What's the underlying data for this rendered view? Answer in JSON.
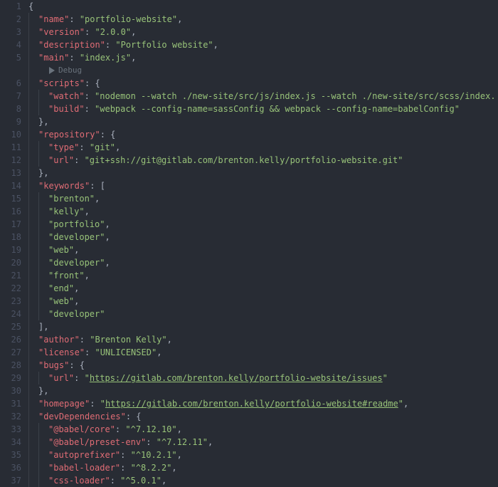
{
  "codelens": {
    "debug_label": "Debug"
  },
  "lines": [
    {
      "n": 1,
      "indent": 0,
      "tokens": [
        {
          "t": "punc",
          "v": "{"
        }
      ]
    },
    {
      "n": 2,
      "indent": 1,
      "tokens": [
        {
          "t": "key",
          "v": "\"name\""
        },
        {
          "t": "punc",
          "v": ": "
        },
        {
          "t": "str",
          "v": "\"portfolio-website\""
        },
        {
          "t": "punc",
          "v": ","
        }
      ]
    },
    {
      "n": 3,
      "indent": 1,
      "tokens": [
        {
          "t": "key",
          "v": "\"version\""
        },
        {
          "t": "punc",
          "v": ": "
        },
        {
          "t": "str",
          "v": "\"2.0.0\""
        },
        {
          "t": "punc",
          "v": ","
        }
      ]
    },
    {
      "n": 4,
      "indent": 1,
      "tokens": [
        {
          "t": "key",
          "v": "\"description\""
        },
        {
          "t": "punc",
          "v": ": "
        },
        {
          "t": "str",
          "v": "\"Portfolio website\""
        },
        {
          "t": "punc",
          "v": ","
        }
      ]
    },
    {
      "n": 5,
      "indent": 1,
      "tokens": [
        {
          "t": "key",
          "v": "\"main\""
        },
        {
          "t": "punc",
          "v": ": "
        },
        {
          "t": "str",
          "v": "\"index.js\""
        },
        {
          "t": "punc",
          "v": ","
        }
      ]
    },
    {
      "codelens": true
    },
    {
      "n": 6,
      "indent": 1,
      "tokens": [
        {
          "t": "key",
          "v": "\"scripts\""
        },
        {
          "t": "punc",
          "v": ": {"
        }
      ]
    },
    {
      "n": 7,
      "indent": 2,
      "tokens": [
        {
          "t": "key",
          "v": "\"watch\""
        },
        {
          "t": "punc",
          "v": ": "
        },
        {
          "t": "str",
          "v": "\"nodemon --watch ./new-site/src/js/index.js --watch ./new-site/src/scss/index."
        }
      ]
    },
    {
      "n": 8,
      "indent": 2,
      "tokens": [
        {
          "t": "key",
          "v": "\"build\""
        },
        {
          "t": "punc",
          "v": ": "
        },
        {
          "t": "str",
          "v": "\"webpack --config-name=sassConfig && webpack --config-name=babelConfig\""
        }
      ]
    },
    {
      "n": 9,
      "indent": 1,
      "tokens": [
        {
          "t": "punc",
          "v": "},"
        }
      ]
    },
    {
      "n": 10,
      "indent": 1,
      "tokens": [
        {
          "t": "key",
          "v": "\"repository\""
        },
        {
          "t": "punc",
          "v": ": {"
        }
      ]
    },
    {
      "n": 11,
      "indent": 2,
      "tokens": [
        {
          "t": "key",
          "v": "\"type\""
        },
        {
          "t": "punc",
          "v": ": "
        },
        {
          "t": "str",
          "v": "\"git\""
        },
        {
          "t": "punc",
          "v": ","
        }
      ]
    },
    {
      "n": 12,
      "indent": 2,
      "tokens": [
        {
          "t": "key",
          "v": "\"url\""
        },
        {
          "t": "punc",
          "v": ": "
        },
        {
          "t": "str",
          "v": "\"git+ssh://git@gitlab.com/brenton.kelly/portfolio-website.git\""
        }
      ]
    },
    {
      "n": 13,
      "indent": 1,
      "tokens": [
        {
          "t": "punc",
          "v": "},"
        }
      ]
    },
    {
      "n": 14,
      "indent": 1,
      "tokens": [
        {
          "t": "key",
          "v": "\"keywords\""
        },
        {
          "t": "punc",
          "v": ": ["
        }
      ]
    },
    {
      "n": 15,
      "indent": 2,
      "tokens": [
        {
          "t": "str",
          "v": "\"brenton\""
        },
        {
          "t": "punc",
          "v": ","
        }
      ]
    },
    {
      "n": 16,
      "indent": 2,
      "tokens": [
        {
          "t": "str",
          "v": "\"kelly\""
        },
        {
          "t": "punc",
          "v": ","
        }
      ]
    },
    {
      "n": 17,
      "indent": 2,
      "tokens": [
        {
          "t": "str",
          "v": "\"portfolio\""
        },
        {
          "t": "punc",
          "v": ","
        }
      ]
    },
    {
      "n": 18,
      "indent": 2,
      "tokens": [
        {
          "t": "str",
          "v": "\"developer\""
        },
        {
          "t": "punc",
          "v": ","
        }
      ]
    },
    {
      "n": 19,
      "indent": 2,
      "tokens": [
        {
          "t": "str",
          "v": "\"web\""
        },
        {
          "t": "punc",
          "v": ","
        }
      ]
    },
    {
      "n": 20,
      "indent": 2,
      "tokens": [
        {
          "t": "str",
          "v": "\"developer\""
        },
        {
          "t": "punc",
          "v": ","
        }
      ]
    },
    {
      "n": 21,
      "indent": 2,
      "tokens": [
        {
          "t": "str",
          "v": "\"front\""
        },
        {
          "t": "punc",
          "v": ","
        }
      ]
    },
    {
      "n": 22,
      "indent": 2,
      "tokens": [
        {
          "t": "str",
          "v": "\"end\""
        },
        {
          "t": "punc",
          "v": ","
        }
      ]
    },
    {
      "n": 23,
      "indent": 2,
      "tokens": [
        {
          "t": "str",
          "v": "\"web\""
        },
        {
          "t": "punc",
          "v": ","
        }
      ]
    },
    {
      "n": 24,
      "indent": 2,
      "tokens": [
        {
          "t": "str",
          "v": "\"developer\""
        }
      ]
    },
    {
      "n": 25,
      "indent": 1,
      "tokens": [
        {
          "t": "punc",
          "v": "],"
        }
      ]
    },
    {
      "n": 26,
      "indent": 1,
      "tokens": [
        {
          "t": "key",
          "v": "\"author\""
        },
        {
          "t": "punc",
          "v": ": "
        },
        {
          "t": "str",
          "v": "\"Brenton Kelly\""
        },
        {
          "t": "punc",
          "v": ","
        }
      ]
    },
    {
      "n": 27,
      "indent": 1,
      "tokens": [
        {
          "t": "key",
          "v": "\"license\""
        },
        {
          "t": "punc",
          "v": ": "
        },
        {
          "t": "str",
          "v": "\"UNLICENSED\""
        },
        {
          "t": "punc",
          "v": ","
        }
      ]
    },
    {
      "n": 28,
      "indent": 1,
      "tokens": [
        {
          "t": "key",
          "v": "\"bugs\""
        },
        {
          "t": "punc",
          "v": ": {"
        }
      ]
    },
    {
      "n": 29,
      "indent": 2,
      "tokens": [
        {
          "t": "key",
          "v": "\"url\""
        },
        {
          "t": "punc",
          "v": ": "
        },
        {
          "t": "str",
          "v": "\""
        },
        {
          "t": "link",
          "v": "https://gitlab.com/brenton.kelly/portfolio-website/issues"
        },
        {
          "t": "str",
          "v": "\""
        }
      ]
    },
    {
      "n": 30,
      "indent": 1,
      "tokens": [
        {
          "t": "punc",
          "v": "},"
        }
      ]
    },
    {
      "n": 31,
      "indent": 1,
      "tokens": [
        {
          "t": "key",
          "v": "\"homepage\""
        },
        {
          "t": "punc",
          "v": ": "
        },
        {
          "t": "str",
          "v": "\""
        },
        {
          "t": "link",
          "v": "https://gitlab.com/brenton.kelly/portfolio-website#readme"
        },
        {
          "t": "str",
          "v": "\""
        },
        {
          "t": "punc",
          "v": ","
        }
      ]
    },
    {
      "n": 32,
      "indent": 1,
      "tokens": [
        {
          "t": "key",
          "v": "\"devDependencies\""
        },
        {
          "t": "punc",
          "v": ": {"
        }
      ]
    },
    {
      "n": 33,
      "indent": 2,
      "tokens": [
        {
          "t": "key",
          "v": "\"@babel/core\""
        },
        {
          "t": "punc",
          "v": ": "
        },
        {
          "t": "str",
          "v": "\"^7.12.10\""
        },
        {
          "t": "punc",
          "v": ","
        }
      ]
    },
    {
      "n": 34,
      "indent": 2,
      "tokens": [
        {
          "t": "key",
          "v": "\"@babel/preset-env\""
        },
        {
          "t": "punc",
          "v": ": "
        },
        {
          "t": "str",
          "v": "\"^7.12.11\""
        },
        {
          "t": "punc",
          "v": ","
        }
      ]
    },
    {
      "n": 35,
      "indent": 2,
      "tokens": [
        {
          "t": "key",
          "v": "\"autoprefixer\""
        },
        {
          "t": "punc",
          "v": ": "
        },
        {
          "t": "str",
          "v": "\"^10.2.1\""
        },
        {
          "t": "punc",
          "v": ","
        }
      ]
    },
    {
      "n": 36,
      "indent": 2,
      "tokens": [
        {
          "t": "key",
          "v": "\"babel-loader\""
        },
        {
          "t": "punc",
          "v": ": "
        },
        {
          "t": "str",
          "v": "\"^8.2.2\""
        },
        {
          "t": "punc",
          "v": ","
        }
      ]
    },
    {
      "n": 37,
      "indent": 2,
      "tokens": [
        {
          "t": "key",
          "v": "\"css-loader\""
        },
        {
          "t": "punc",
          "v": ": "
        },
        {
          "t": "str",
          "v": "\"^5.0.1\""
        },
        {
          "t": "punc",
          "v": ","
        }
      ]
    }
  ]
}
